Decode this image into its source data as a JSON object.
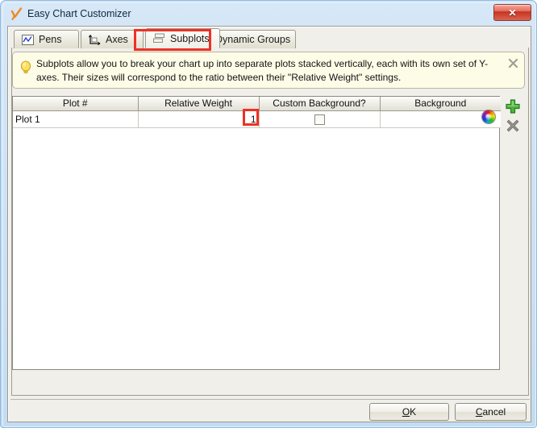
{
  "window": {
    "title": "Easy Chart Customizer",
    "title_icon": "easy-chart-icon",
    "close_label": "✕"
  },
  "tabs": [
    {
      "id": "pens",
      "label": "Pens",
      "icon": "pen-line-chart-icon",
      "selected": false
    },
    {
      "id": "axes",
      "label": "Axes",
      "icon": "axes-icon",
      "selected": false
    },
    {
      "id": "subplots",
      "label": "Subplots",
      "icon": "subplots-stacked-icon",
      "selected": true
    },
    {
      "id": "dynamic-groups",
      "label": "Dynamic Groups",
      "icon": "",
      "selected": false
    }
  ],
  "hint": {
    "icon": "lightbulb-icon",
    "text": "Subplots allow you to break your chart up into separate plots stacked vertically, each with its own set of Y-axes. Their sizes will correspond to the ratio between their \"Relative Weight\" settings.",
    "close_icon": "close-hint-icon"
  },
  "table": {
    "columns": [
      "Plot #",
      "Relative Weight",
      "Custom Background?",
      "Background"
    ],
    "rows": [
      {
        "plot": "Plot 1",
        "relative_weight": "1",
        "custom_background_checked": false,
        "background_value": ""
      }
    ]
  },
  "side_buttons": {
    "add": "add-row-button",
    "remove": "remove-row-button"
  },
  "footer": {
    "ok_mnemonic": "O",
    "ok_rest": "K",
    "cancel_mnemonic": "C",
    "cancel_rest": "ancel"
  },
  "annotations": {
    "subplots_tab_highlight_color": "#ee3124",
    "relative_weight_highlight_color": "#ee3124"
  },
  "colors": {
    "title_bar": "#cfe3f5",
    "client_bg": "#f0efe9",
    "hint_bg": "#fdfce7",
    "grid_bg": "#ffffff",
    "close_button": "#d4503c",
    "add_button": "#3aa02c",
    "remove_button": "#8b8b84"
  }
}
